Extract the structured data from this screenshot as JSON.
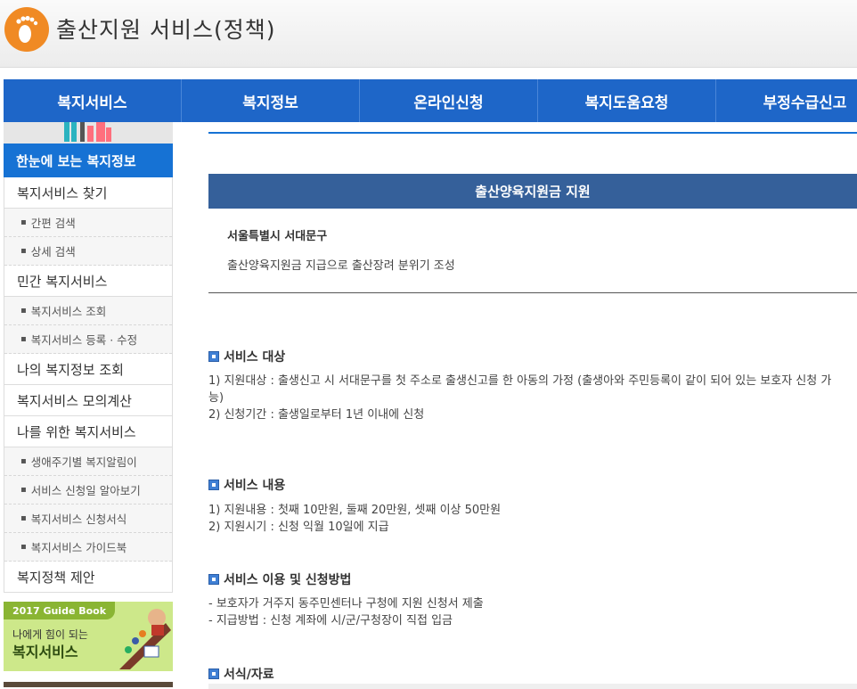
{
  "header": {
    "title": "출산지원 서비스(정책)",
    "logo_icon": "footprint-icon",
    "logo_color": "#f08a24"
  },
  "nav": {
    "items": [
      "복지서비스",
      "복지정보",
      "온라인신청",
      "복지도움요청",
      "부정수급신고"
    ]
  },
  "sidebar": {
    "title": "한눈에 보는 복지정보",
    "items": [
      {
        "label": "복지서비스 찾기",
        "type": "main"
      },
      {
        "label": "간편 검색",
        "type": "sub"
      },
      {
        "label": "상세 검색",
        "type": "sub"
      },
      {
        "label": "민간 복지서비스",
        "type": "main"
      },
      {
        "label": "복지서비스 조회",
        "type": "sub"
      },
      {
        "label": "복지서비스 등록 · 수정",
        "type": "sub"
      },
      {
        "label": "나의 복지정보 조회",
        "type": "main"
      },
      {
        "label": "복지서비스 모의계산",
        "type": "main"
      },
      {
        "label": "나를 위한 복지서비스",
        "type": "main"
      },
      {
        "label": "생애주기별 복지알림이",
        "type": "sub"
      },
      {
        "label": "서비스 신청일 알아보기",
        "type": "sub"
      },
      {
        "label": "복지서비스 신청서식",
        "type": "sub"
      },
      {
        "label": "복지서비스 가이드북",
        "type": "sub"
      },
      {
        "label": "복지정책 제안",
        "type": "main"
      }
    ],
    "guide_book": {
      "tag": "2017 Guide Book",
      "subtitle": "나에게 힘이 되는",
      "title": "복지서비스"
    }
  },
  "content": {
    "banner": "출산양육지원금 지원",
    "org": "서울특별시 서대문구",
    "summary": "출산양육지원금 지급으로 출산장려 분위기 조성",
    "sections": [
      {
        "heading": "서비스 대상",
        "lines": [
          "1) 지원대상 : 출생신고 시 서대문구를 첫 주소로 출생신고를 한 아동의 가정 (출생아와 주민등록이 같이 되어 있는 보호자 신청 가",
          "능)",
          "2) 신청기간 : 출생일로부터 1년 이내에 신청"
        ]
      },
      {
        "heading": "서비스 내용",
        "lines": [
          "1) 지원내용 : 첫째 10만원, 둘째 20만원, 셋째 이상 50만원",
          "2) 지원시기 : 신청 익월 10일에 지급"
        ]
      },
      {
        "heading": "서비스 이용 및 신청방법",
        "lines": [
          "- 보호자가 거주지 동주민센터나 구청에 지원 신청서 제출",
          "- 지급방법 : 신청 계좌에 시/군/구청장이 직접 입금"
        ]
      },
      {
        "heading": "서식/자료",
        "lines": []
      }
    ]
  },
  "colors": {
    "nav_bg": "#1e66c8",
    "sidebar_title_bg": "#1672d4",
    "banner_bg": "#35609a"
  }
}
